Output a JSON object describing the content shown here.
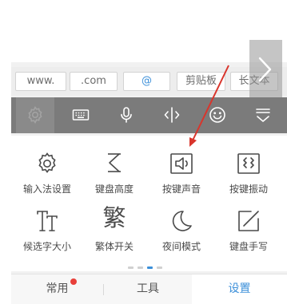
{
  "shortcuts": [
    {
      "label": "www."
    },
    {
      "label": ".com"
    },
    {
      "label": "@"
    },
    {
      "label": "剪贴板"
    },
    {
      "label": "长文本"
    }
  ],
  "toolbar": {
    "buttons": [
      {
        "icon": "gear-icon"
      },
      {
        "icon": "keyboard-icon"
      },
      {
        "icon": "microphone-icon"
      },
      {
        "icon": "text-cursor-icon"
      },
      {
        "icon": "smiley-icon"
      },
      {
        "icon": "collapse-keyboard-icon"
      }
    ]
  },
  "settings": {
    "items": [
      {
        "label": "输入法设置",
        "icon": "gear-icon"
      },
      {
        "label": "键盘高度",
        "icon": "keyboard-height-icon"
      },
      {
        "label": "按键声音",
        "icon": "key-sound-icon"
      },
      {
        "label": "按键振动",
        "icon": "key-vibration-icon"
      },
      {
        "label": "候选字大小",
        "icon": "candidate-size-icon"
      },
      {
        "label": "繁体开关",
        "icon": "traditional-chinese-icon"
      },
      {
        "label": "夜间模式",
        "icon": "night-mode-icon"
      },
      {
        "label": "键盘手写",
        "icon": "handwriting-icon"
      }
    ],
    "traditional_glyph": "繁"
  },
  "tabs": [
    {
      "label": "常用"
    },
    {
      "label": "工具"
    },
    {
      "label": "设置"
    }
  ],
  "colors": {
    "accent": "#3b8fd9",
    "toolbar": "#7b7b7b",
    "badge": "#e8403a",
    "arrow": "#d9352c"
  }
}
